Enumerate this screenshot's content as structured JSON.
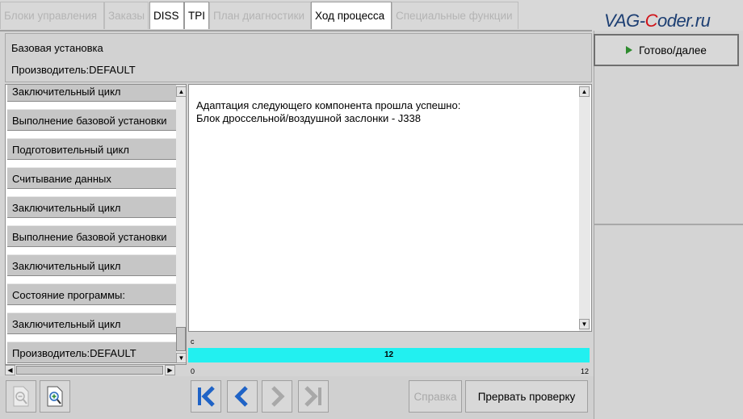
{
  "tabs": [
    {
      "label": "Блоки управления",
      "active": false
    },
    {
      "label": "Заказы",
      "active": false
    },
    {
      "label": "DISS",
      "active": true
    },
    {
      "label": "TPI",
      "active": true
    },
    {
      "label": "План диагностики",
      "active": false
    },
    {
      "label": "Ход процесса",
      "active": true
    },
    {
      "label": "Специальные функции",
      "active": false
    }
  ],
  "logo": {
    "prefix": "VAG-",
    "accent": "C",
    "suffix": "oder.ru"
  },
  "header": {
    "line1": "Базовая установка",
    "line2": "Производитель:DEFAULT"
  },
  "steps": [
    "Заключительный цикл",
    "Выполнение базовой установки",
    "Подготовительный цикл",
    "Считывание данных",
    "Заключительный цикл",
    "Выполнение базовой установки",
    "Заключительный цикл",
    "Состояние программы:",
    "Заключительный цикл",
    "Производитель:DEFAULT"
  ],
  "message": {
    "line1": "Адаптация следующего компонента прошла успешно:",
    "line2": "Блок дроссельной/воздушной заслонки - J338"
  },
  "progress": {
    "unit": "c",
    "value": "12",
    "min": "0",
    "max": "12",
    "fraction": 1.0
  },
  "buttons": {
    "first": "first-icon",
    "prev": "prev-icon",
    "next": "next-icon",
    "last": "last-icon",
    "help": "Справка",
    "abort": "Прервать проверку",
    "go": "Готово/далее"
  },
  "colors": {
    "progress_fill": "#22f0f0",
    "nav_blue": "#1f63c6",
    "go_arrow": "#2e8b2e"
  }
}
